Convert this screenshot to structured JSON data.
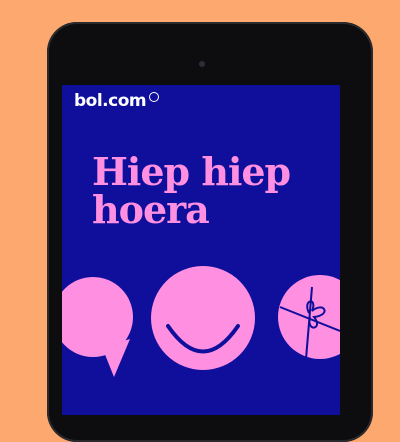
{
  "brand": {
    "logo_text": "bol.com",
    "colors": {
      "background": "#FCA86E",
      "screen": "#0f0f9c",
      "accent": "#ff8fe1",
      "device": "#0d0d0f"
    }
  },
  "headline": {
    "line1": "Hiep hiep",
    "line2": "hoera"
  },
  "icons": [
    "speech-bubble-icon",
    "smiley-face-icon",
    "gift-icon"
  ]
}
